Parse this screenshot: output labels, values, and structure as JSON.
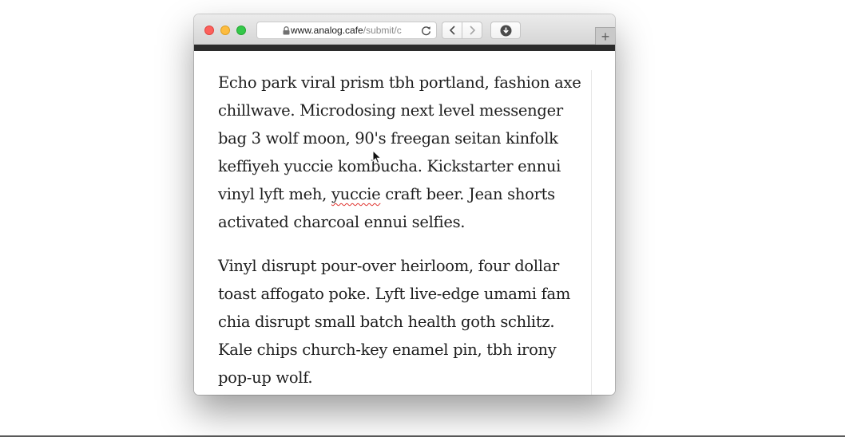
{
  "browser": {
    "url_host": "www.analog.cafe",
    "url_path": "/submit/c",
    "new_tab_label": "+"
  },
  "article": {
    "paragraph_1": {
      "line_1": "Echo park viral prism tbh portland, fashion axe",
      "line_2": "chillwave. Microdosing next level messenger",
      "line_3": "bag 3 wolf moon, 90's freegan seitan kinfolk",
      "line_4": "keffiyeh yuccie kombucha. Kickstarter ennui",
      "line_5_before": "vinyl lyft meh, ",
      "line_5_misspelled": "yuccie",
      "line_5_after": " craft beer. Jean shorts",
      "line_6": "activated charcoal ennui selfies."
    },
    "paragraph_2": {
      "line_1": "Vinyl disrupt pour-over heirloom, four dollar",
      "line_2": "toast affogato poke. Lyft live-edge umami fam",
      "line_3": "chia disrupt small batch health goth schlitz.",
      "line_4": "Kale chips church-key enamel pin, tbh irony",
      "line_5": "pop-up wolf."
    }
  },
  "icons": {
    "lock": "lock-icon",
    "reload": "reload-icon",
    "back": "chevron-left-icon",
    "forward": "chevron-right-icon",
    "download": "download-icon",
    "cursor": "mouse-pointer-icon"
  },
  "colors": {
    "close": "#fc605c",
    "minimize": "#fdbc40",
    "maximize": "#34c84a",
    "header_bar": "#2b2b2b",
    "spellcheck_underline": "#e0342f"
  }
}
